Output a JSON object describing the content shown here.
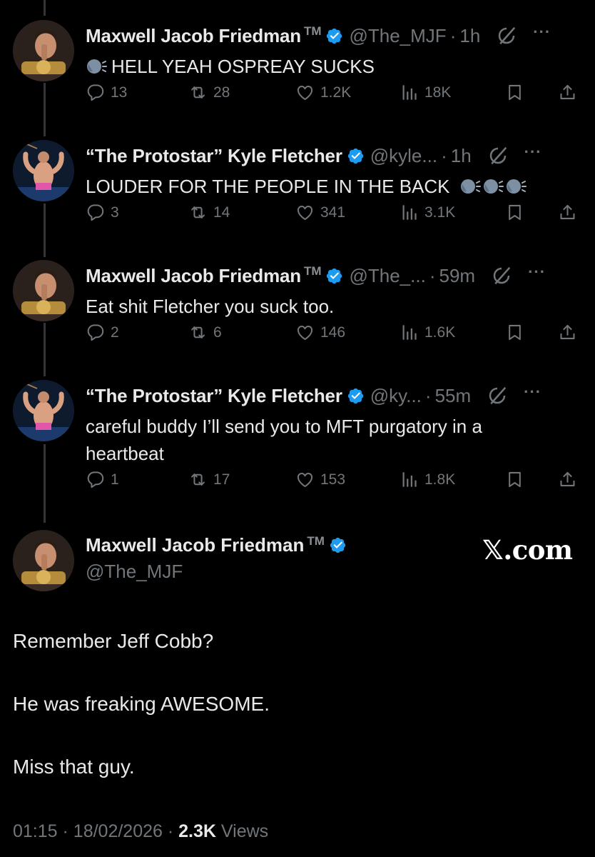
{
  "replies": [
    {
      "name": "Maxwell Jacob Friedman",
      "tm": "TM",
      "handle": "@The_MJF",
      "time": "1h",
      "emoji": "speaking-head",
      "text": "HELL YEAH OSPREAY SUCKS",
      "replies": "13",
      "reposts": "28",
      "likes": "1.2K",
      "views": "18K",
      "avatar": "mjf-avatar"
    },
    {
      "name": "“The Protostar” Kyle Fletcher",
      "tm": "",
      "handle": "@kyle...",
      "time": "1h",
      "text": "LOUDER FOR THE PEOPLE IN THE BACK",
      "trailing_emoji": [
        "speaking-head",
        "speaking-head",
        "speaking-head"
      ],
      "replies": "3",
      "reposts": "14",
      "likes": "341",
      "views": "3.1K",
      "avatar": "fletcher-avatar"
    },
    {
      "name": "Maxwell Jacob Friedman",
      "tm": "TM",
      "handle": "@The_...",
      "time": "59m",
      "text": "Eat shit Fletcher you suck too.",
      "replies": "2",
      "reposts": "6",
      "likes": "146",
      "views": "1.6K",
      "avatar": "mjf-avatar"
    },
    {
      "name": "“The Protostar” Kyle Fletcher",
      "tm": "",
      "handle": "@ky...",
      "time": "55m",
      "text": "careful buddy I’ll send you to MFT purgatory in a heartbeat",
      "replies": "1",
      "reposts": "17",
      "likes": "153",
      "views": "1.8K",
      "avatar": "fletcher-avatar"
    }
  ],
  "main": {
    "name": "Maxwell Jacob Friedman",
    "tm": "TM",
    "handle": "@The_MJF",
    "paragraphs": [
      "Remember Jeff Cobb?",
      "He was freaking AWESOME.",
      "Miss that guy."
    ],
    "time": "01:15",
    "date": "18/02/2026",
    "views_count": "2.3K",
    "views_label": "Views"
  },
  "watermark": {
    "x": "𝕏",
    "domain": ".com"
  },
  "colors": {
    "background": "#000000",
    "text": "#e7e9ea",
    "muted": "#71767b",
    "verified": "#1d9bf0"
  }
}
